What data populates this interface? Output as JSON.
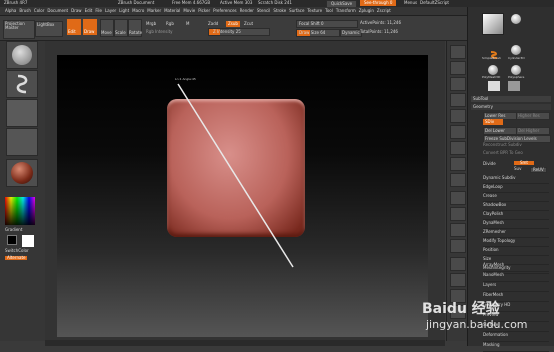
{
  "titlebar": {
    "app": "ZBrush 4R7",
    "document": "ZBrush Document",
    "memory": "Free Mem 4.667GB",
    "active_mem": "Active Mem 303",
    "scratch": "Scratch Disk 241",
    "quicksave": "QuickSave",
    "see_through": "See-through 0",
    "menus": "Menus",
    "default_script": "DefaultZScript"
  },
  "menu": [
    "Alpha",
    "Brush",
    "Color",
    "Document",
    "Draw",
    "Edit",
    "File",
    "Layer",
    "Light",
    "Macro",
    "Marker",
    "Material",
    "Movie",
    "Picker",
    "Preferences",
    "Render",
    "Stencil",
    "Stroke",
    "Surface",
    "Texture",
    "Tool",
    "Transform",
    "Zplugin",
    "Zscript"
  ],
  "toolbar": {
    "projection_master": "Projection Master",
    "lightbox": "LightBox",
    "edit": "Edit",
    "draw": "Draw",
    "move": "Move",
    "scale": "Scale",
    "rotate": "Rotate",
    "mrgb": "Mrgb",
    "rgb": "Rgb",
    "m": "M",
    "rgb_intensity": "Rgb Intensity",
    "zadd": "Zadd",
    "zsub": "Zsub",
    "zcut": "Zcut",
    "z_intensity": "Z Intensity 25",
    "focal_shift": "Focal Shift 0",
    "draw_size": "Draw Size 64",
    "dynamic": "Dynamic",
    "active_points": "ActivePoints: 11,246",
    "total_points": "TotalPoints: 11,246"
  },
  "leftshelf": {
    "gradient": "Gradient",
    "switch_color": "SwitchColor",
    "alternate": "Alternate"
  },
  "canvas": {
    "cursor_label": "Ln:1 Angle:45"
  },
  "tray": {
    "subtool": "SubTool",
    "geometry": "Geometry",
    "lower_res": "Lower Res",
    "higher_res": "Higher Res",
    "sdiv": "SDiv",
    "del_lower": "Del Lower",
    "del_higher": "Del Higher",
    "freeze": "Freeze SubDivision Levels",
    "reconstruct": "Reconstruct Subdiv",
    "convert": "Convert BPR To Geo",
    "divide": "Divide",
    "smt": "Smt",
    "suv": "Suv",
    "reuv": "ReUV",
    "items": [
      "Dynamic Subdiv",
      "EdgeLoop",
      "Crease",
      "ShadowBox",
      "ClayPolish",
      "DynaMesh",
      "ZRemesher",
      "Modify Topology",
      "Position",
      "Size",
      "MeshIntegrity"
    ],
    "lower": [
      "ArrayMesh",
      "NanoMesh",
      "Layers",
      "FiberMesh",
      "Geometry HD",
      "Preview",
      "Surface",
      "Deformation",
      "Masking"
    ],
    "brush_labels": [
      "SimpleBrush",
      "Cylinder3D",
      "PolyMesh3D",
      "Polysphere"
    ]
  },
  "watermark": {
    "text": "jingyan.baidu.com",
    "brand": "Baidu 经验"
  }
}
